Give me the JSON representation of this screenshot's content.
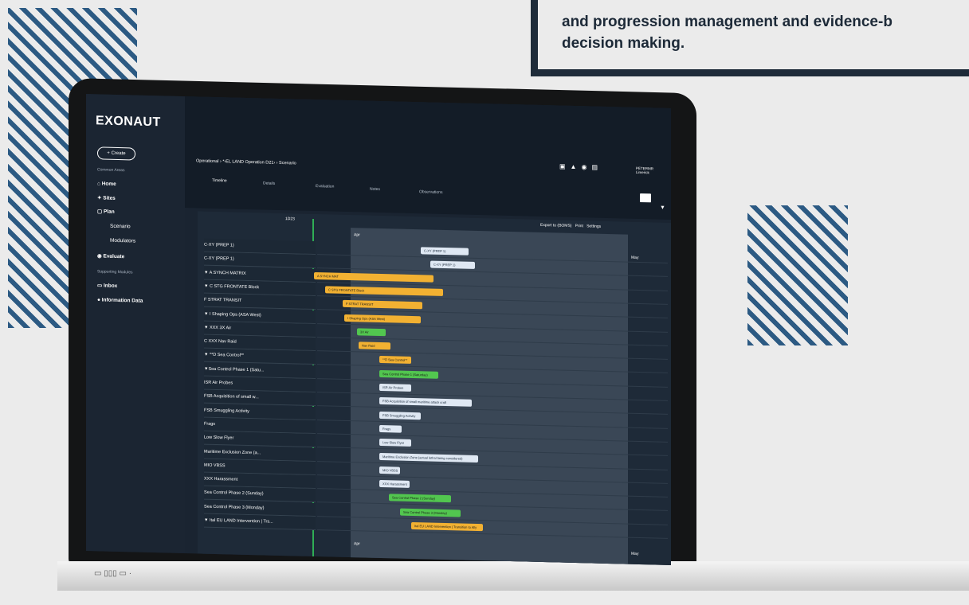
{
  "quote": {
    "text": "and progression management and evidence-b\ndecision making."
  },
  "app": {
    "logo": "EXONAUT",
    "create_button": "+ Create",
    "sidebar_sections": [
      "Common Areas",
      "Supporting Modules"
    ],
    "nav": [
      {
        "label": "Home",
        "icon": "home-icon"
      },
      {
        "label": "Sites",
        "icon": "pin-icon"
      },
      {
        "label": "Plan",
        "icon": "plan-icon"
      },
      {
        "label": "Scenario",
        "sub": true
      },
      {
        "label": "Modulators",
        "sub": true
      },
      {
        "label": "Evaluate",
        "icon": "eye-icon"
      },
      {
        "label": "Inbox",
        "icon": "inbox-icon"
      },
      {
        "label": "Information Data",
        "icon": "info-icon"
      }
    ],
    "breadcrumb": "Operational  ›  *‹EL LAND Operation D21›  › Scenario",
    "tabs": [
      "Timeline",
      "Details",
      "Evaluation",
      "Notes",
      "Observations"
    ],
    "user": "PETERMR\nLimerick",
    "actions": [
      "Export to (BOMS)",
      "Print",
      "Settings"
    ],
    "axis": {
      "left": "1D23",
      "top_mid": "Apr",
      "top_right": "May",
      "bottom_mid": "Apr",
      "bottom_right": "May"
    },
    "rows": [
      "C-XY (PREP 1)",
      "C-XY (PREP 1)",
      "▼ A SYNCH MATRIX",
      "▼ C STG FRONTATE Block",
      "F STRAT TRANSIT",
      "▼ I Shaping Ops (ASA West)",
      "▼ XXX 3X Air",
      "C XXX Nav Raid",
      "▼ **D Sea Control**",
      "▼Sea Control Phase 1 (Satu...",
      "ISR Air Probes",
      "FSB Acquisition of small w...",
      "FSB Smuggling Activity",
      "Frags",
      "Low Slow Flyer",
      "Maritime Exclusion Zone (a...",
      "MIO VBSS",
      "XXX Harassment",
      "Sea Control Phase 2 (Sunday)",
      "Sea Control Phase 3 (Monday)",
      "▼ Ital EU LAND Intervention | Trs..."
    ],
    "bars": [
      {
        "label": "C-XY (PREP 1)",
        "color": "b"
      },
      {
        "label": "C-XY (PREP 1)",
        "color": "b"
      },
      {
        "label": "A SYNCH MAT",
        "color": "o"
      },
      {
        "label": "C STG FRONTATE Block",
        "color": "o"
      },
      {
        "label": "F STRAT TRANSIT",
        "color": "o"
      },
      {
        "label": "I Shaping Ops (ASA West)",
        "color": "o"
      },
      {
        "label": "3X Air",
        "color": "g"
      },
      {
        "label": "Nav Raid",
        "color": "o"
      },
      {
        "label": "**D Sea Control**",
        "color": "o"
      },
      {
        "label": "Sea Control Phase 1 (Saturday)",
        "color": "g"
      },
      {
        "label": "ISR Air Probes",
        "color": "b"
      },
      {
        "label": "FSB Acquisition of small maritime attack craft",
        "color": "b"
      },
      {
        "label": "FSB Smuggling Activity",
        "color": "b"
      },
      {
        "label": "Frags",
        "color": "b"
      },
      {
        "label": "Low Slow Flyer",
        "color": "b"
      },
      {
        "label": "Maritime Exclusion Zone (actual lethal being considered)",
        "color": "b"
      },
      {
        "label": "MIO VBSS",
        "color": "b"
      },
      {
        "label": "XXX Harassment",
        "color": "b"
      },
      {
        "label": "Sea Control Phase 2 (Sunday)",
        "color": "g"
      },
      {
        "label": "Sea Control Phase 3 (Monday)",
        "color": "g"
      },
      {
        "label": "Ital EU LAND Intervention | Transition to Ally",
        "color": "o"
      }
    ]
  }
}
